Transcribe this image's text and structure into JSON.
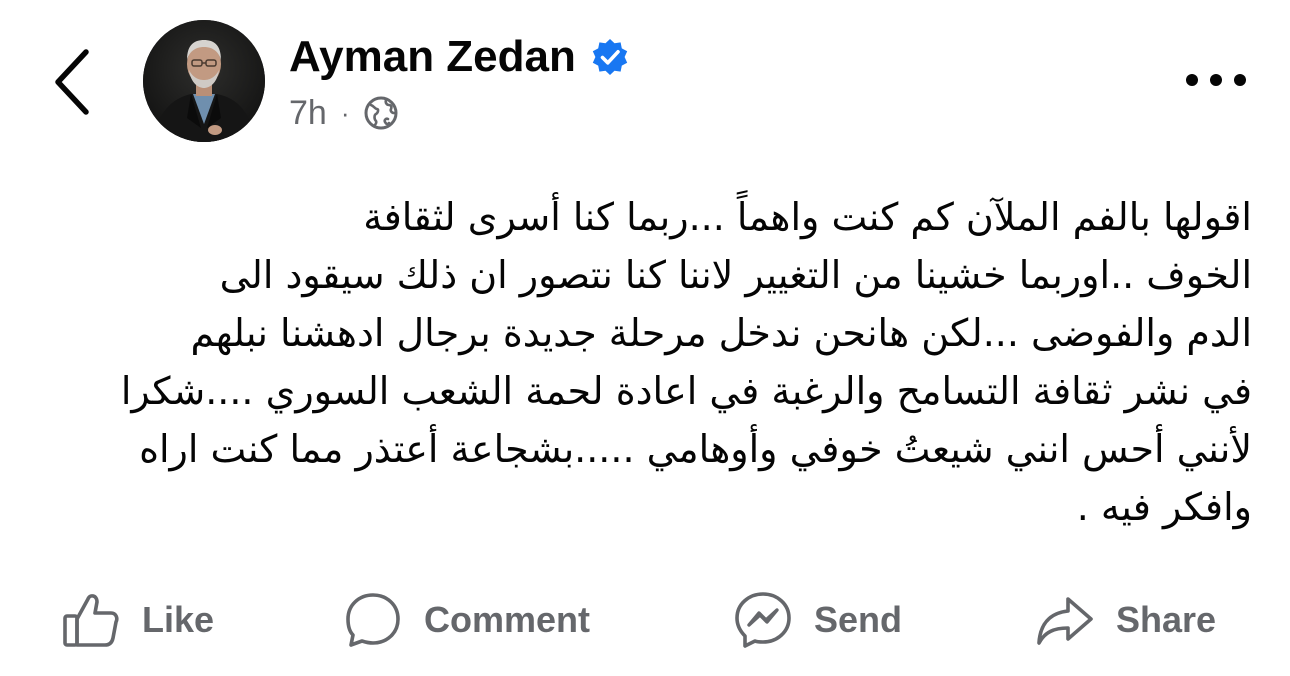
{
  "header": {
    "author_name": "Ayman Zedan",
    "timestamp": "7h",
    "separator": "·",
    "audience_icon": "globe-icon",
    "verified_icon": "verified-badge-icon",
    "verified_color": "#1877F2",
    "back_icon": "chevron-left-icon",
    "more_icon": "more-horizontal-icon"
  },
  "post": {
    "lines": [
      "اقولها بالفم الملآن كم كنت واهماً ...ربما كنا أسرى لثقافة",
      "الخوف ..اوربما خشينا من التغيير لاننا كنا نتصور ان ذلك سيقود الى",
      "الدم والفوضى ...لكن هانحن ندخل مرحلة جديدة برجال ادهشنا نبلهم",
      "في نشر ثقافة التسامح والرغبة في اعادة لحمة الشعب السوري ....شكرا",
      "لأنني أحس انني شيعتُ خوفي وأوهامي .....بشجاعة أعتذر مما كنت اراه",
      "وافكر فيه ."
    ]
  },
  "actions": {
    "like_label": "Like",
    "comment_label": "Comment",
    "send_label": "Send",
    "share_label": "Share",
    "color": "#65676B"
  }
}
